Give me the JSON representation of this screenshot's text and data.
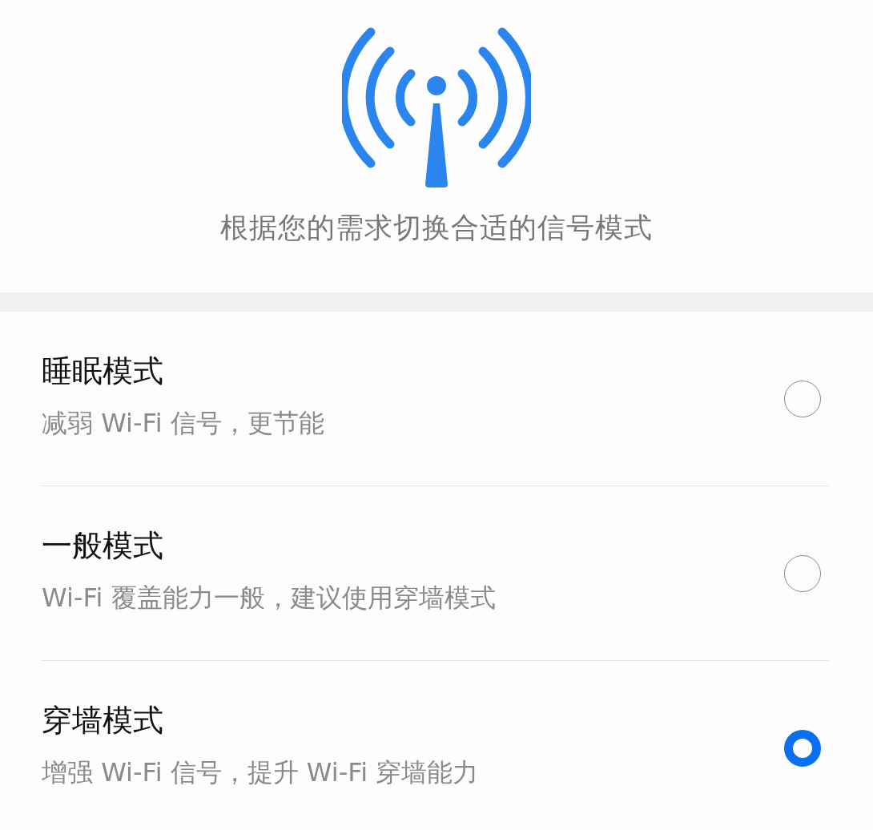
{
  "header": {
    "description": "根据您的需求切换合适的信号模式"
  },
  "modes": [
    {
      "title": "睡眠模式",
      "subtitle": "减弱 Wi-Fi 信号，更节能",
      "selected": false
    },
    {
      "title": "一般模式",
      "subtitle": "Wi-Fi 覆盖能力一般，建议使用穿墙模式",
      "selected": false
    },
    {
      "title": "穿墙模式",
      "subtitle": "增强 Wi-Fi 信号，提升 Wi-Fi 穿墙能力",
      "selected": true
    }
  ]
}
